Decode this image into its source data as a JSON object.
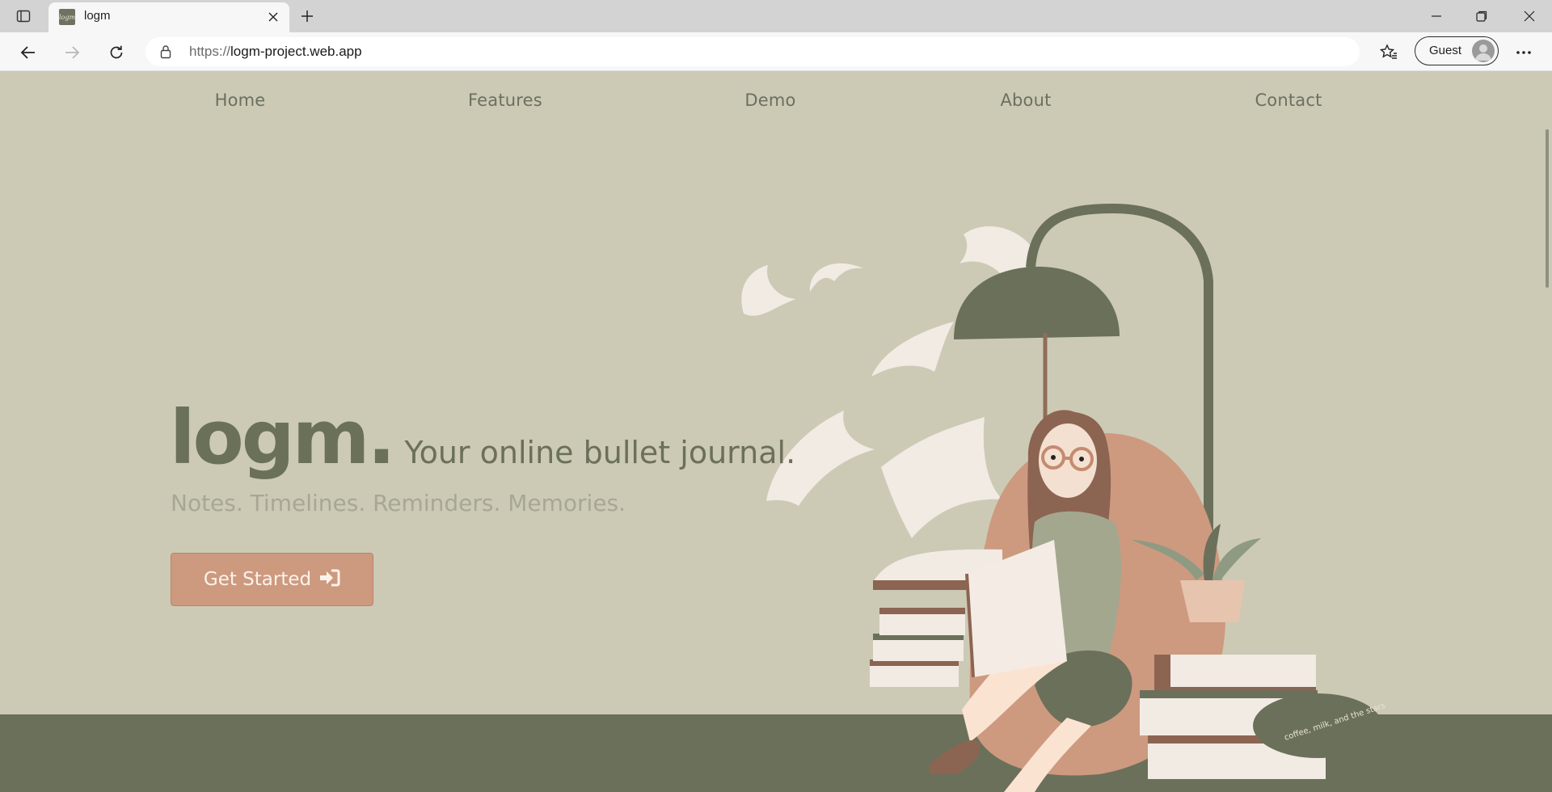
{
  "browser": {
    "tab": {
      "title": "logm",
      "favicon_text": "logm"
    },
    "url_scheme": "https://",
    "url_host": "logm-project.web.app",
    "profile_label": "Guest"
  },
  "nav": {
    "items": [
      "Home",
      "Features",
      "Demo",
      "About",
      "Contact"
    ]
  },
  "hero": {
    "brand": "logm.",
    "tagline": "Your online bullet journal.",
    "subtitle": "Notes. Timelines. Reminders. Memories.",
    "cta_label": "Get Started",
    "cta_icon": "sign-in-icon"
  },
  "illustration": {
    "signature": "coffee, milk, and the stars",
    "subject": "reading-woman-icon"
  },
  "colors": {
    "page_bg": "#cccab5",
    "brand_text": "#6b7059",
    "accent": "#cd9a7f",
    "floor": "#6b705b"
  }
}
